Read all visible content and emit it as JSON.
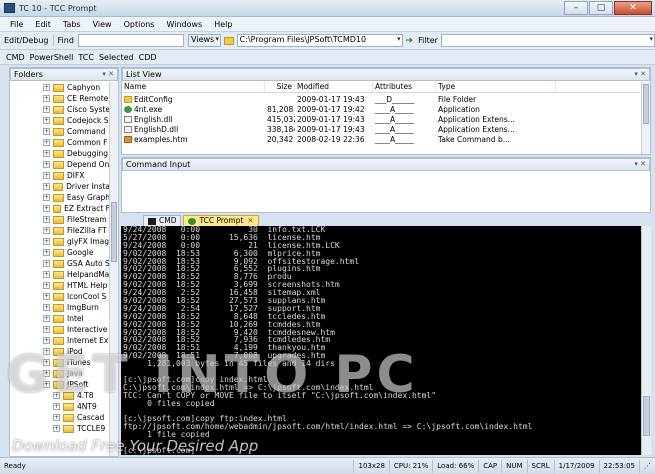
{
  "window": {
    "title": "TC 10 - TCC Prompt"
  },
  "menu": [
    "File",
    "Edit",
    "Tabs",
    "View",
    "Options",
    "Windows",
    "Help"
  ],
  "toolbar1": {
    "edit_debug": "Edit/Debug",
    "find": "Find",
    "views": "Views",
    "path": "C:\\Program Files\\JPSoft\\TCMD10",
    "filter": "Filter"
  },
  "toolbar2": [
    "CMD",
    "PowerShell",
    "TCC",
    "Selected",
    "CDD"
  ],
  "folders": {
    "header": "Folders",
    "items": [
      "Caphyon",
      "CE Remote",
      "Cisco Syste",
      "Codejock S",
      "Command",
      "Common F",
      "Debugging",
      "Depend On",
      "DIFX",
      "Driver Insta",
      "Easy Graph",
      "EZ Extract F",
      "FileStream",
      "FileZilla FT",
      "glyFX Imag",
      "Google",
      "GSA Auto S",
      "HelpandMa",
      "HTML Help",
      "IconCool S",
      "ImgBurn",
      "Intel",
      "Interactive",
      "Internet Ex",
      "iPod",
      "iTunes",
      "Java",
      "JPSoft",
      "4.T8",
      "4NT9",
      "Cascad",
      "TCCLE9"
    ]
  },
  "listview": {
    "header": "List View",
    "columns": [
      "Name",
      "Size",
      "Modified",
      "Attributes",
      "Type"
    ],
    "rows": [
      {
        "name": "EditConfig",
        "size": "",
        "modified": "2009-01-17 19:43",
        "attr": "___D______",
        "type": "File Folder",
        "icon": "folder-icon"
      },
      {
        "name": "4nt.exe",
        "size": "81,208",
        "modified": "2009-01-17 19:42",
        "attr": "____A_____",
        "type": "Application",
        "icon": "application-icon"
      },
      {
        "name": "English.dll",
        "size": "415,032",
        "modified": "2009-01-17 19:43",
        "attr": "____A_____",
        "type": "Application Extens...",
        "icon": "dll-icon"
      },
      {
        "name": "EnglishD.dll",
        "size": "338,184",
        "modified": "2009-01-17 19:43",
        "attr": "____A_____",
        "type": "Application Extens...",
        "icon": "dll-icon"
      },
      {
        "name": "examples.htm",
        "size": "20,342",
        "modified": "2008-02-19 22:36",
        "attr": "____A_____",
        "type": "Take Command b...",
        "icon": "html-icon"
      }
    ]
  },
  "command_input": {
    "header": "Command Input"
  },
  "tabs": [
    {
      "label": "CMD"
    },
    {
      "label": "TCC Prompt"
    }
  ],
  "console_lines": [
    "9/24/2008   0:00          30  info.txt.LCK",
    "5/27/2008   0:00      15,636  license.htm",
    "9/24/2008   0:00          21  license.htm.LCK",
    "9/02/2008  18:53       6,300  mlprice.htm",
    "9/02/2008  18:53       9,092  offsitestorage.html",
    "9/02/2008  18:52       6,552  plugins.htm",
    "9/02/2008  18:52       8,776  produ",
    "9/02/2008  18:52       3,699  screenshots.htm",
    "9/24/2008   2:52      16,458  sitemap.xml",
    "9/02/2008  18:52      27,573  supplans.htm",
    "9/24/2008   2:54      17,527  support.htm",
    "9/02/2008  18:52       8,648  tccledes.htm",
    "9/02/2008  18:52      10,269  tcmddes.htm",
    "9/02/2008  18:52       9,420  tcmddesnew.htm",
    "9/02/2008  18:52       7,936  tcmdledes.htm",
    "9/02/2008  18:51       4,199  thankyou.htm",
    "9/02/2008  18:51       7,008  upgrades.htm",
    "     1,281,003 bytes in 45 files and 14 dirs",
    "",
    "[c:\\jpsoft.com]copy index.html",
    "C:\\jpsoft.com\\index.html => C:\\jpsoft.com\\index.html",
    "TCC: Can't COPY or MOVE file to itself \"C:\\jpsoft.com\\index.html\"",
    "     0 files copied",
    "",
    "[c:\\jpsoft.com]copy ftp:index.html .",
    "ftp://jpsoft.com/home/webadmin/jpsoft.com/html/index.html => C:\\jpsoft.com\\index.html",
    "     1 file copied",
    "",
    "[c:\\jpsoft.com]"
  ],
  "status": {
    "left": "Ready",
    "size": "103x28",
    "cpu": "CPU: 21%",
    "load": "Load: 66%",
    "cap": "CAP",
    "num": "NUM",
    "scrl": "SCRL",
    "date": "1/17/2009",
    "time": "22:53:05"
  },
  "watermark": {
    "big": "GET INTO PC",
    "small": "Download Free Your Desired App"
  }
}
